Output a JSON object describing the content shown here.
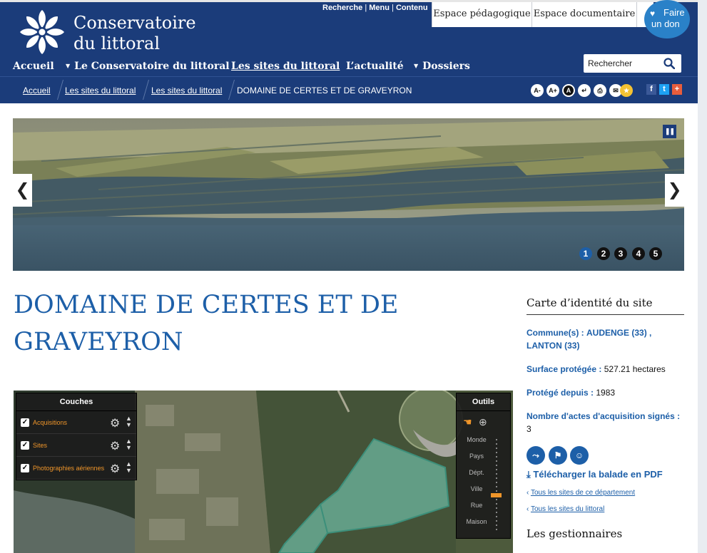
{
  "header": {
    "logo_line1": "Conservatoire",
    "logo_line2": "du littoral",
    "utility": [
      "Recherche",
      "Menu",
      "Contenu"
    ],
    "tabs": [
      "Espace pédagogique",
      "Espace documentaire"
    ],
    "donate_line1": "Faire",
    "donate_line2": "un don",
    "nav": [
      "Accueil",
      "Le Conservatoire du littoral",
      "Les sites du littoral",
      "L’actualité",
      "Dossiers"
    ],
    "search_placeholder": "Rechercher"
  },
  "breadcrumb": [
    "Accueil",
    "Les sites du littoral",
    "Les sites du littoral",
    "DOMAINE DE CERTES ET DE GRAVEYRON"
  ],
  "tools": [
    "A-",
    "A+",
    "A",
    "↵",
    "⎙",
    "✉",
    "★"
  ],
  "social": [
    "f",
    "t",
    "+"
  ],
  "slider": {
    "dots": [
      "1",
      "2",
      "3",
      "4",
      "5"
    ],
    "active": 1
  },
  "page_title": "DOMAINE DE CERTES ET DE GRAVEYRON",
  "map": {
    "layers_title": "Couches",
    "layers": [
      "Acquisitions",
      "Sites",
      "Photographies aériennes"
    ],
    "tools_title": "Outils",
    "scale": [
      "Monde",
      "Pays",
      "Dépt.",
      "Ville",
      "Rue",
      "Maison"
    ]
  },
  "sidebar": {
    "title": "Carte d’identité du site",
    "communes_label": "Commune(s) :",
    "communes_value": "AUDENGE (33) , LANTON (33)",
    "surface_label": "Surface protégée :",
    "surface_value": "527.21 hectares",
    "since_label": "Protégé depuis :",
    "since_value": "1983",
    "acts_label": "Nombre d'actes d'acquisition signés :",
    "acts_value": "3",
    "pdf_link": "Télécharger la balade en PDF",
    "links": [
      "Tous les sites de ce département",
      "Tous les sites du littoral"
    ],
    "gestionnaires": "Les gestionnaires"
  },
  "colors": {
    "brand_navy": "#1b3c7a",
    "link_blue": "#1d5fa8",
    "accent_orange": "#f0962a"
  }
}
